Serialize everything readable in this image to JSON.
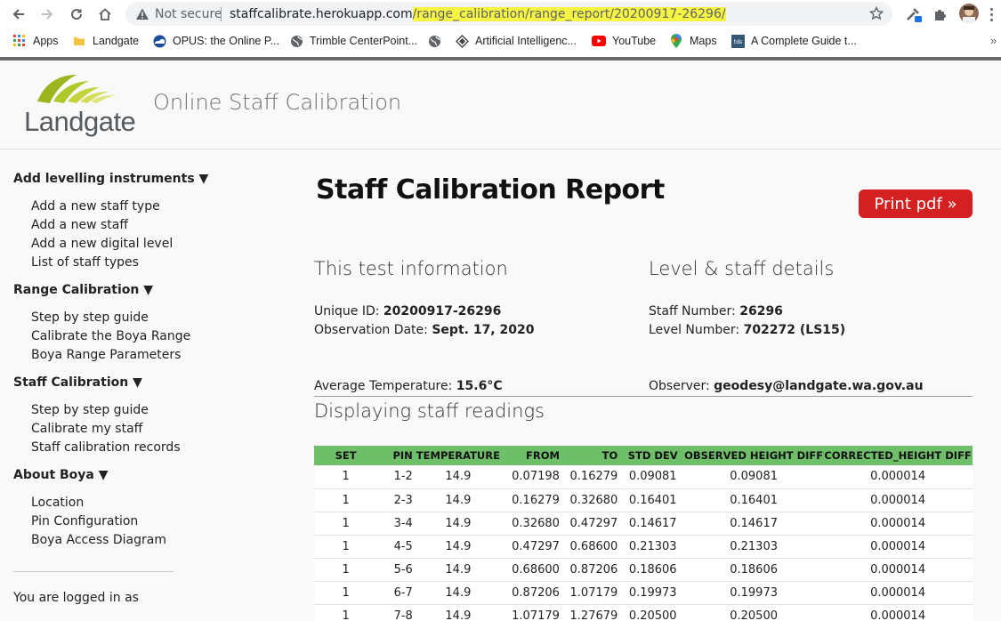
{
  "browser": {
    "not_secure_label": "Not secure",
    "url_host": "staffcalibrate.herokuapp.com",
    "url_path": "/range_calibration/range_report/20200917-26296/",
    "bookmarks": [
      {
        "label": "Apps",
        "icon": "apps-grid-icon"
      },
      {
        "label": "Landgate",
        "icon": "folder-icon"
      },
      {
        "label": "OPUS: the Online P...",
        "icon": "noaa-icon"
      },
      {
        "label": "Trimble CenterPoint...",
        "icon": "globe-icon"
      },
      {
        "label": "",
        "icon": "globe-icon"
      },
      {
        "label": "Artificial Intelligenc...",
        "icon": "diamond-icon"
      },
      {
        "label": "YouTube",
        "icon": "youtube-icon"
      },
      {
        "label": "Maps",
        "icon": "maps-pin-icon"
      },
      {
        "label": "A Complete Guide t...",
        "icon": "tds-icon"
      }
    ],
    "more_bookmarks": "»"
  },
  "header": {
    "logo_text": "Landgate",
    "site_title": "Online Staff Calibration"
  },
  "sidebar": {
    "sections": [
      {
        "title": "Add levelling instruments ▼",
        "links": [
          "Add a new staff type",
          "Add a new staff",
          "Add a new digital level",
          "List of staff types"
        ]
      },
      {
        "title": "Range Calibration ▼",
        "links": [
          "Step by step guide",
          "Calibrate the Boya Range",
          "Boya Range Parameters"
        ]
      },
      {
        "title": "Staff Calibration ▼",
        "links": [
          "Step by step guide",
          "Calibrate my staff",
          "Staff calibration records"
        ]
      },
      {
        "title": "About Boya ▼",
        "links": [
          "Location",
          "Pin Configuration",
          "Boya Access Diagram"
        ]
      }
    ],
    "logged_in_text": "You are logged in as"
  },
  "report": {
    "title": "Staff Calibration Report",
    "print_button": "Print pdf »",
    "test_info_title": "This test information",
    "level_staff_title": "Level & staff details",
    "unique_id_label": "Unique ID: ",
    "unique_id": "20200917-26296",
    "observation_date_label": "Observation Date: ",
    "observation_date": "Sept. 17, 2020",
    "staff_number_label": "Staff Number: ",
    "staff_number": "26296",
    "level_number_label": "Level Number: ",
    "level_number": "702272 (LS15)",
    "avg_temp_label": "Average Temperature: ",
    "avg_temp": "15.6°C",
    "observer_label": "Observer: ",
    "observer": "geodesy@landgate.wa.gov.au",
    "readings_title": "Displaying staff readings"
  },
  "table": {
    "columns": [
      "SET",
      "PIN",
      "TEMPERATURE",
      "FROM",
      "TO",
      "STD DEV",
      "OBSERVED HEIGHT DIFF",
      "CORRECTED_HEIGHT DIFF"
    ],
    "rows": [
      [
        "1",
        "1-2",
        "14.9",
        "0.07198",
        "0.16279",
        "0.09081",
        "0.09081",
        "0.000014"
      ],
      [
        "1",
        "2-3",
        "14.9",
        "0.16279",
        "0.32680",
        "0.16401",
        "0.16401",
        "0.000014"
      ],
      [
        "1",
        "3-4",
        "14.9",
        "0.32680",
        "0.47297",
        "0.14617",
        "0.14617",
        "0.000014"
      ],
      [
        "1",
        "4-5",
        "14.9",
        "0.47297",
        "0.68600",
        "0.21303",
        "0.21303",
        "0.000014"
      ],
      [
        "1",
        "5-6",
        "14.9",
        "0.68600",
        "0.87206",
        "0.18606",
        "0.18606",
        "0.000014"
      ],
      [
        "1",
        "6-7",
        "14.9",
        "0.87206",
        "1.07179",
        "0.19973",
        "0.19973",
        "0.000014"
      ],
      [
        "1",
        "7-8",
        "14.9",
        "1.07179",
        "1.27679",
        "0.20500",
        "0.20500",
        "0.000014"
      ]
    ]
  },
  "colors": {
    "accent_red": "#d42020",
    "table_header_green": "#6fbf6a",
    "url_highlight": "#f5f542"
  }
}
